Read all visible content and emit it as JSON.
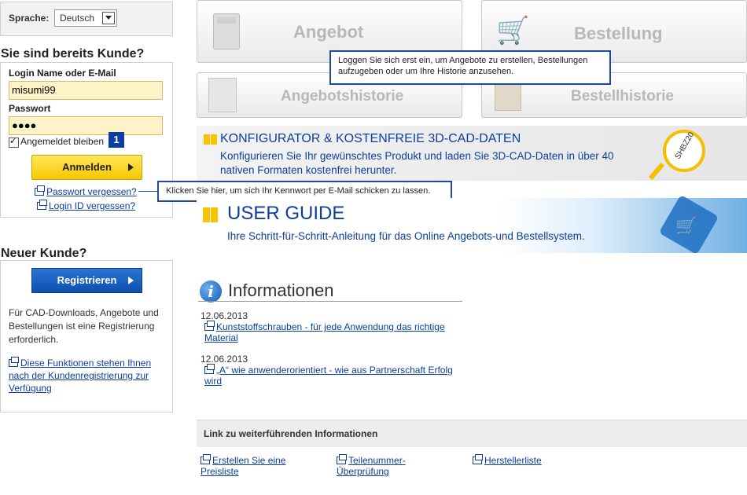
{
  "language": {
    "label": "Sprache:",
    "selected": "Deutsch"
  },
  "login": {
    "heading": "Sie sind bereits Kunde?",
    "username_label": "Login Name oder E-Mail",
    "username_value": "misumi99",
    "password_label": "Passwort",
    "password_value": "●●●●",
    "remember_label": "Angemeldet bleiben",
    "step_badge": "1",
    "submit_label": "Anmelden",
    "forgot_password": "Passwort vergessen?",
    "forgot_login": "Login ID vergessen?"
  },
  "tooltips": {
    "tiles": "Loggen Sie sich erst ein, um Angebote zu erstellen, Bestellungen aufzugeben oder um Ihre Historie anzusehen.",
    "password": "Klicken Sie hier, um sich Ihr Kennwort per E-Mail schicken zu lassen."
  },
  "new_customer": {
    "heading": "Neuer Kunde?",
    "register_label": "Registrieren",
    "text": "Für CAD-Downloads, Angebote und Bestellungen ist eine Registrierung erforderlich.",
    "link": "Diese Funktionen stehen Ihnen nach der Kundenregistrierung zur Verfügung"
  },
  "tiles": [
    {
      "label": "Angebot",
      "icon": "calculator-icon"
    },
    {
      "label": "Bestellung",
      "icon": "cart-icon"
    },
    {
      "label": "Angebotshistorie",
      "icon": "document-search-icon"
    },
    {
      "label": "Bestellhistorie",
      "icon": "box-search-icon"
    }
  ],
  "banner_cad": {
    "title": "KONFIGURATOR & KOSTENFREIE 3D-CAD-DATEN",
    "text": "Konfigurieren Sie Ihr gewünschtes Produkt und laden Sie 3D-CAD-Daten in über 40 nativen Formaten kostenfrei herunter.",
    "lens_text": "SHBZ20"
  },
  "banner_guide": {
    "title": "USER GUIDE",
    "text": "Ihre Schritt-für-Schritt-Anleitung für das Online Angebots-und Bestellsystem."
  },
  "info": {
    "title": "Informationen",
    "items": [
      {
        "date": "12.06.2013",
        "link": "Kunststoffschrauben - für jede Anwendung das richtige Material"
      },
      {
        "date": "12.06.2013",
        "link": "„A“ wie anwenderorientiert - wie aus Partnerschaft Erfolg wird"
      }
    ]
  },
  "further_links": {
    "title": "Link zu weiterführenden Informationen",
    "items": [
      "Erstellen Sie eine Preisliste",
      "Teilenummer-Überprüfung",
      "Herstellerliste"
    ]
  },
  "colors": {
    "link_blue": "#0b3e9e",
    "accent_yellow": "#f7c400",
    "field_bg": "#fdf3c6",
    "tooltip_border": "#1b4aa0"
  }
}
